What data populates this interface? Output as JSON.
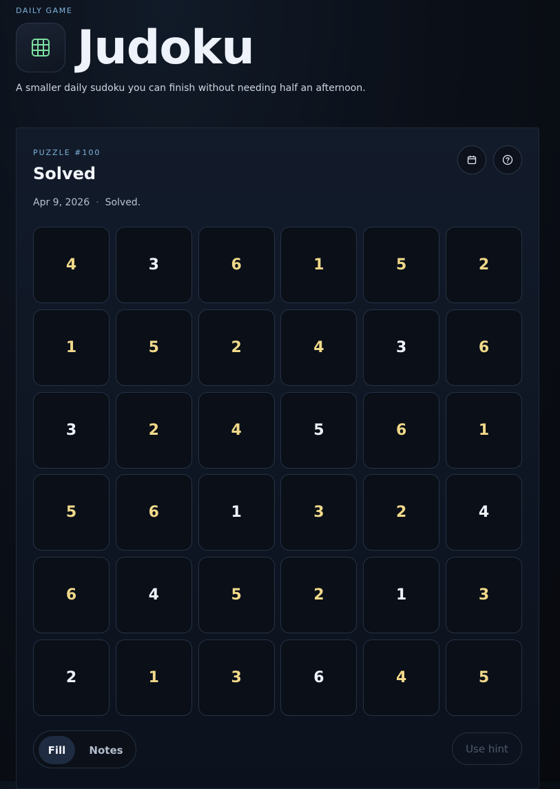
{
  "header": {
    "eyebrow": "DAILY GAME",
    "title": "Judoku",
    "subtitle": "A smaller daily sudoku you can finish without needing half an afternoon.",
    "icon": "grid-icon"
  },
  "puzzle": {
    "label": "PUZZLE #100",
    "status": "Solved",
    "date": "Apr 9, 2026",
    "status_note": "Solved.",
    "actions": [
      {
        "icon": "calendar-icon"
      },
      {
        "icon": "help-icon"
      }
    ],
    "grid": [
      [
        {
          "v": "4",
          "t": "user"
        },
        {
          "v": "3",
          "t": "given"
        },
        {
          "v": "6",
          "t": "user"
        },
        {
          "v": "1",
          "t": "user"
        },
        {
          "v": "5",
          "t": "user"
        },
        {
          "v": "2",
          "t": "user"
        }
      ],
      [
        {
          "v": "1",
          "t": "user"
        },
        {
          "v": "5",
          "t": "user"
        },
        {
          "v": "2",
          "t": "user"
        },
        {
          "v": "4",
          "t": "user"
        },
        {
          "v": "3",
          "t": "given"
        },
        {
          "v": "6",
          "t": "user"
        }
      ],
      [
        {
          "v": "3",
          "t": "given"
        },
        {
          "v": "2",
          "t": "user"
        },
        {
          "v": "4",
          "t": "user"
        },
        {
          "v": "5",
          "t": "given"
        },
        {
          "v": "6",
          "t": "user"
        },
        {
          "v": "1",
          "t": "user"
        }
      ],
      [
        {
          "v": "5",
          "t": "user"
        },
        {
          "v": "6",
          "t": "user"
        },
        {
          "v": "1",
          "t": "given"
        },
        {
          "v": "3",
          "t": "user"
        },
        {
          "v": "2",
          "t": "user"
        },
        {
          "v": "4",
          "t": "given"
        }
      ],
      [
        {
          "v": "6",
          "t": "user"
        },
        {
          "v": "4",
          "t": "given"
        },
        {
          "v": "5",
          "t": "user"
        },
        {
          "v": "2",
          "t": "user"
        },
        {
          "v": "1",
          "t": "given"
        },
        {
          "v": "3",
          "t": "user"
        }
      ],
      [
        {
          "v": "2",
          "t": "given"
        },
        {
          "v": "1",
          "t": "user"
        },
        {
          "v": "3",
          "t": "user"
        },
        {
          "v": "6",
          "t": "given"
        },
        {
          "v": "4",
          "t": "user"
        },
        {
          "v": "5",
          "t": "user"
        }
      ]
    ]
  },
  "controls": {
    "fill_label": "Fill",
    "notes_label": "Notes",
    "active_mode": "fill",
    "hint_label": "Use hint"
  },
  "colors": {
    "accent": "#7fb6dc",
    "user_digit": "#f1d98a",
    "given_digit": "#eef2fa",
    "icon_green": "#7ee0a1"
  }
}
